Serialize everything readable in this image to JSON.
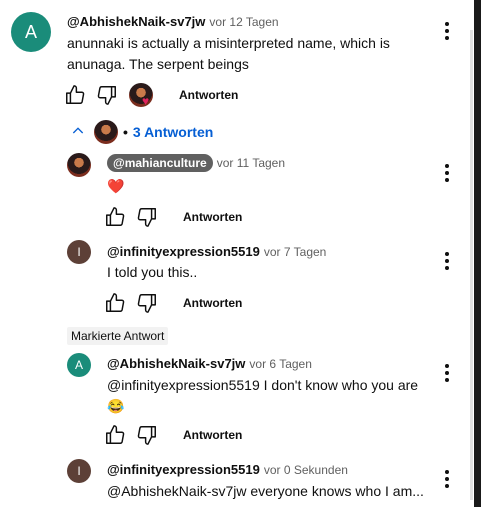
{
  "comment": {
    "avatar_letter": "A",
    "avatar_color": "#1a8c7a",
    "author": "@AbhishekNaik-sv7jw",
    "time": "vor 12 Tagen",
    "text": "anunnaki is actually a misinterpreted name, which is anunaga. The serpent beings",
    "reply_label": "Antworten"
  },
  "replies_toggle": {
    "label": "3 Antworten",
    "bullet": "•",
    "color": "#065fd4"
  },
  "replies": [
    {
      "author": "@mahianculture",
      "time": "vor 11 Tagen",
      "text": "❤️",
      "reply_label": "Antworten"
    },
    {
      "avatar_letter": "I",
      "avatar_color": "#5d4037",
      "author": "@infinityexpression5519",
      "time": "vor 7 Tagen",
      "text": "I told you this..",
      "reply_label": "Antworten"
    },
    {
      "badge": "Markierte Antwort",
      "avatar_letter": "A",
      "avatar_color": "#1a8c7a",
      "author": "@AbhishekNaik-sv7jw",
      "time": "vor 6 Tagen",
      "text": "@infinityexpression5519  I don't know who you are 😂",
      "reply_label": "Antworten"
    },
    {
      "avatar_letter": "I",
      "avatar_color": "#5d4037",
      "author": "@infinityexpression5519",
      "time": "vor 0 Sekunden",
      "text": "@AbhishekNaik-sv7jw everyone knows who I am..."
    }
  ]
}
